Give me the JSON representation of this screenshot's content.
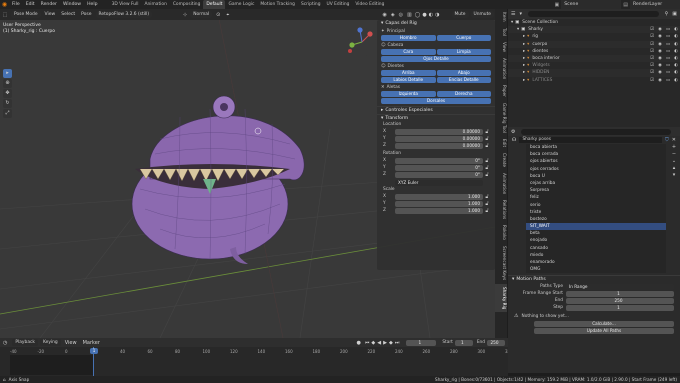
{
  "topbar": {
    "menus": [
      "File",
      "Edit",
      "Render",
      "Window",
      "Help"
    ],
    "workspaces": [
      "3D View Full",
      "Animation",
      "Compositing",
      "Default",
      "Game Logic",
      "Motion Tracking",
      "Scripting",
      "UV Editing",
      "Video Editing"
    ],
    "active_workspace": "Default",
    "scene": "Scene",
    "view_layer": "RenderLayer"
  },
  "viewport_header": {
    "mode": "Pose Mode",
    "menus": [
      "View",
      "Select",
      "Pose"
    ],
    "addon": "RetopoFlow 3.2.6 (still)",
    "orientation": "Normal",
    "mode_right": [
      "Mute",
      "Unmute"
    ]
  },
  "viewport": {
    "perspective": "User Perspective",
    "object": "(1) Sharky_rig : Cuerpo"
  },
  "npanel": {
    "panel_title": "Capas del Rig",
    "sections": [
      {
        "title": "Principal",
        "buttons": [
          [
            "Hombro",
            "Cuerpo"
          ]
        ]
      },
      {
        "title": "Cabeza",
        "buttons": [
          [
            "Cara",
            "Limpia"
          ],
          [
            "Ojos Detalle"
          ]
        ]
      },
      {
        "title": "Dientes",
        "buttons": [
          [
            "Arriba",
            "Abajo"
          ],
          [
            "Labios Detalle",
            "Encias Detalle"
          ]
        ]
      },
      {
        "title": "Aletas",
        "buttons": [
          [
            "Izquierda",
            "Derecha"
          ],
          [
            "Dorsales"
          ]
        ]
      }
    ],
    "controls_title": "Controles Especiales",
    "transform_title": "Transform",
    "location_label": "Location",
    "location": [
      [
        "X",
        "0.00000"
      ],
      [
        "Y",
        "0.00000"
      ],
      [
        "Z",
        "0.00000"
      ]
    ],
    "rotation_label": "Rotation",
    "rotation": [
      [
        "X",
        "0°"
      ],
      [
        "Y",
        "0°"
      ],
      [
        "Z",
        "0°"
      ]
    ],
    "rotation_mode": "XYZ Euler",
    "scale_label": "Scale",
    "scale": [
      [
        "X",
        "1.000"
      ],
      [
        "Y",
        "1.000"
      ],
      [
        "Z",
        "1.000"
      ]
    ]
  },
  "vtabs": [
    "Item",
    "Tool",
    "View",
    "Animation",
    "Paper",
    "Game Rig Tool",
    "Edit",
    "Create",
    "Animation",
    "Relations",
    "Rokoko",
    "Screencast Keys",
    "Sharky Rig"
  ],
  "outliner": {
    "title": "Scene Collection",
    "rows": [
      {
        "name": "Scene Collection",
        "indent": 0
      },
      {
        "name": "Sharky",
        "indent": 1
      },
      {
        "name": "rig",
        "indent": 2
      },
      {
        "name": "cuerpo",
        "indent": 2
      },
      {
        "name": "dientes",
        "indent": 2
      },
      {
        "name": "boca interior",
        "indent": 2
      },
      {
        "name": "Widgets",
        "indent": 2
      },
      {
        "name": "HIDDEN",
        "indent": 2
      },
      {
        "name": "LATTICES",
        "indent": 2
      }
    ]
  },
  "properties": {
    "object": "Sharky poses",
    "poses": [
      "boca abierta",
      "boca cerrada",
      "ojos abiertos",
      "ojos cerrados",
      "boca U",
      "cejas arriba",
      "Sorpresa",
      "feliz",
      "serio",
      "triste",
      "bostezo",
      "SIT_WAIT",
      "beta",
      "enojado",
      "cansado",
      "miedo",
      "enamorado",
      "OMG"
    ],
    "selected_pose": "SIT_WAIT",
    "motion_title": "Motion Paths",
    "paths_type_label": "Paths Type",
    "paths_type": "In Range",
    "frame_start_label": "Frame Range Start",
    "frame_start": "1",
    "end_label": "End",
    "end": "250",
    "step_label": "Step",
    "step": "1",
    "nothing_label": "Nothing to show yet...",
    "calculate": "Calculate...",
    "update_all": "Update All Paths"
  },
  "timeline": {
    "menus": [
      "Playback",
      "Keying",
      "View",
      "Marker"
    ],
    "current_frame": "1",
    "start_label": "Start",
    "start": "1",
    "end_label": "End",
    "end": "250",
    "ticks": [
      "-40",
      "-20",
      "0",
      "20",
      "40",
      "60",
      "80",
      "100",
      "120",
      "140",
      "160",
      "180",
      "200",
      "220",
      "240",
      "260",
      "280",
      "300",
      "320",
      "340"
    ]
  },
  "statusbar": {
    "left": "Axis Snap",
    "right": "Sharky_rig | Bones:0/73601 | Objects:1/42 | Memory: 159.2 MiB | VRAM: 1.0/2.0 GiB | 2.90.0 | Start Frame (249 left)"
  }
}
